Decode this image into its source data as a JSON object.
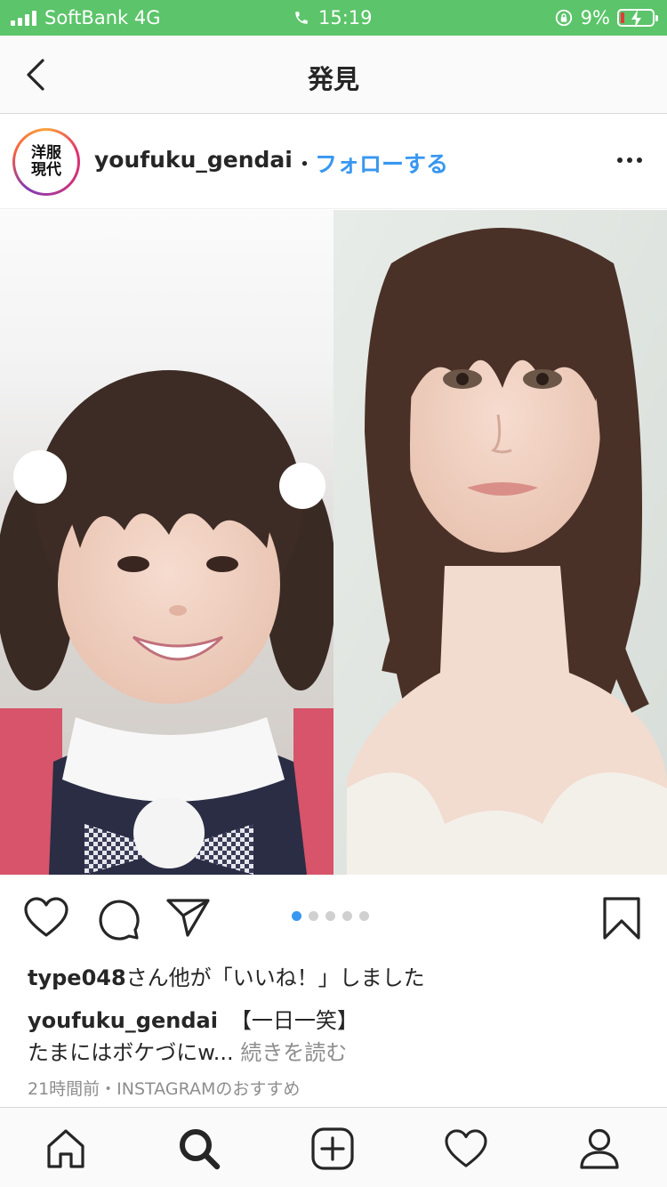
{
  "status_bar": {
    "carrier": "SoftBank 4G",
    "time": "15:19",
    "battery": "9%"
  },
  "nav": {
    "title": "発見"
  },
  "post": {
    "avatar_text_line1": "洋服",
    "avatar_text_line2": "現代",
    "username": "youfuku_gendai",
    "separator": "・",
    "follow_label": "フォローする",
    "carousel_total": 5,
    "carousel_active": 1,
    "likes": {
      "user": "type048",
      "rest": "さん他が「いいね！」しました"
    },
    "caption": {
      "user": "youfuku_gendai",
      "text": "【一日一笑】"
    },
    "caption_line2": {
      "text": "たまにはボケづにw...",
      "more": " 続きを読む"
    },
    "meta": "21時間前・INSTAGRAMのおすすめ"
  },
  "colors": {
    "status_green": "#5cc46a",
    "link_blue": "#3897f0",
    "dot_active": "#3897f0"
  },
  "icons": {
    "nav_back": "chevron-left-icon",
    "actions": [
      "heart-icon",
      "comment-icon",
      "share-icon",
      "bookmark-icon"
    ],
    "tabs": [
      "home-icon",
      "search-icon",
      "new-post-icon",
      "activity-heart-icon",
      "profile-icon"
    ]
  }
}
